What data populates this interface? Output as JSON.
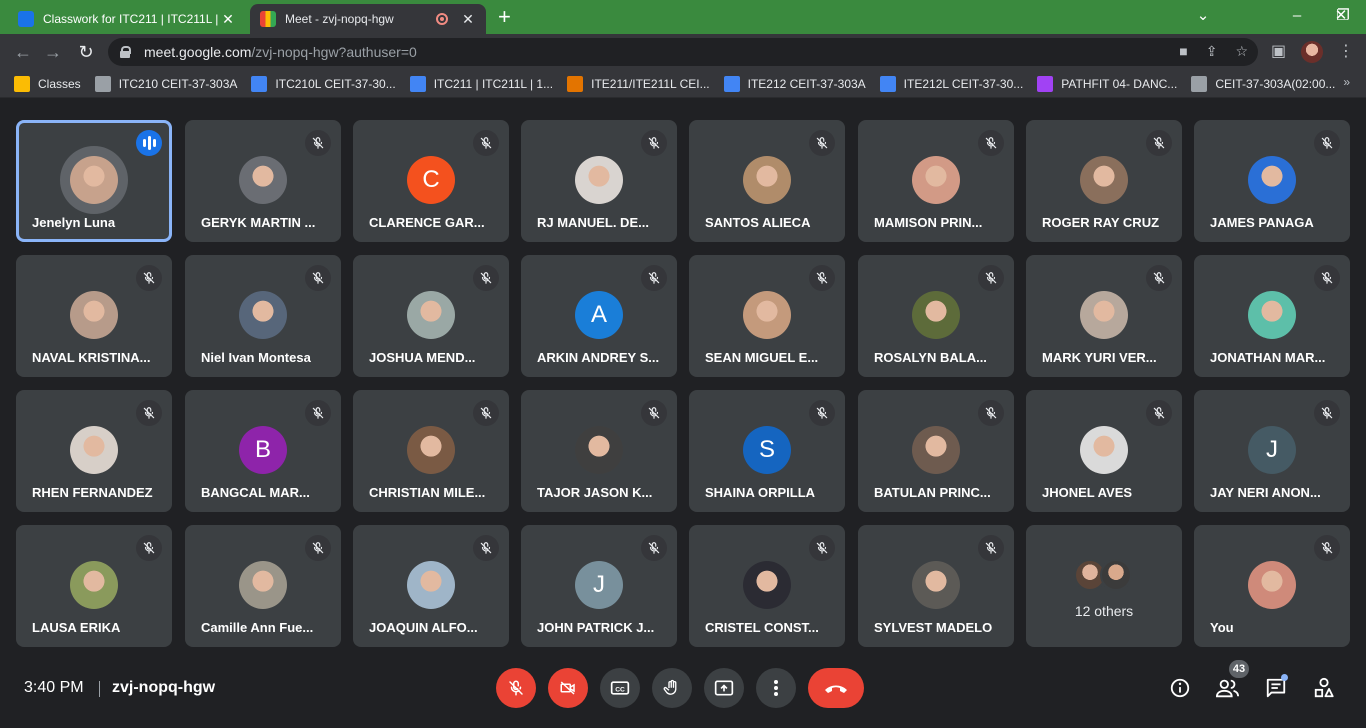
{
  "browser": {
    "tabs": [
      {
        "title": "Classwork for ITC211 | ITC211L | ",
        "icon": "classroom-favicon",
        "color": "#1e8e3e"
      },
      {
        "title": "Meet - zvj-nopq-hgw",
        "icon": "meet-favicon",
        "color": "#00832d"
      }
    ],
    "url_domain": "meet.google.com",
    "url_path": "/zvj-nopq-hgw?authuser=0",
    "bookmarks": [
      {
        "label": "Classes",
        "color": "#fbbc04"
      },
      {
        "label": "ITC210 CEIT-37-303A",
        "color": "#9aa0a6"
      },
      {
        "label": "ITC210L CEIT-37-30...",
        "color": "#4285f4"
      },
      {
        "label": "ITC211 | ITC211L | 1...",
        "color": "#4285f4"
      },
      {
        "label": "ITE211/ITE211L CEI...",
        "color": "#e37400"
      },
      {
        "label": "ITE212 CEIT-37-303A",
        "color": "#4285f4"
      },
      {
        "label": "ITE212L CEIT-37-30...",
        "color": "#4285f4"
      },
      {
        "label": "PATHFIT 04- DANC...",
        "color": "#a142f4"
      },
      {
        "label": "CEIT-37-303A(02:00...",
        "color": "#9aa0a6"
      }
    ],
    "bookmarks_more": "»"
  },
  "participants": [
    {
      "name": "Jenelyn Luna",
      "speaking": true,
      "avatar": "photo",
      "bg": "#c7a28c"
    },
    {
      "name": "GERYK MARTIN ...",
      "avatar": "photo",
      "bg": "#6a6d73"
    },
    {
      "name": "CLARENCE GAR...",
      "avatar": "letter",
      "letter": "C",
      "bg": "#f4511e"
    },
    {
      "name": "RJ MANUEL. DE...",
      "avatar": "photo",
      "bg": "#d9d4d0"
    },
    {
      "name": "SANTOS ALIECA",
      "avatar": "photo",
      "bg": "#b08c6a"
    },
    {
      "name": "MAMISON PRIN...",
      "avatar": "photo",
      "bg": "#d29a86"
    },
    {
      "name": "ROGER RAY CRUZ",
      "avatar": "photo",
      "bg": "#8a6f5c"
    },
    {
      "name": "JAMES PANAGA",
      "avatar": "photo",
      "bg": "#2a6fd6"
    },
    {
      "name": "NAVAL KRISTINA...",
      "avatar": "photo",
      "bg": "#b79b8a"
    },
    {
      "name": "Niel Ivan Montesa",
      "avatar": "photo",
      "bg": "#57667a"
    },
    {
      "name": "JOSHUA MEND...",
      "avatar": "photo",
      "bg": "#9aa8a5"
    },
    {
      "name": "ARKIN ANDREY S...",
      "avatar": "letter",
      "letter": "A",
      "bg": "#1a7ed8"
    },
    {
      "name": "SEAN MIGUEL E...",
      "avatar": "photo",
      "bg": "#c49a7c"
    },
    {
      "name": "ROSALYN BALA...",
      "avatar": "photo",
      "bg": "#5d6b3a"
    },
    {
      "name": "MARK YURI VER...",
      "avatar": "photo",
      "bg": "#b7a89c"
    },
    {
      "name": "JONATHAN MAR...",
      "avatar": "photo",
      "bg": "#5dbfa9"
    },
    {
      "name": "RHEN FERNANDEZ",
      "avatar": "photo",
      "bg": "#d7cfc8"
    },
    {
      "name": "BANGCAL MAR...",
      "avatar": "letter",
      "letter": "B",
      "bg": "#8e24aa"
    },
    {
      "name": "CHRISTIAN MILE...",
      "avatar": "photo",
      "bg": "#7a5a44"
    },
    {
      "name": "TAJOR JASON K...",
      "avatar": "photo",
      "bg": "#3f3f3f"
    },
    {
      "name": "SHAINA ORPILLA",
      "avatar": "letter",
      "letter": "S",
      "bg": "#1565c0"
    },
    {
      "name": "BATULAN PRINC...",
      "avatar": "photo",
      "bg": "#6e5b4f"
    },
    {
      "name": "JHONEL AVES",
      "avatar": "photo",
      "bg": "#dadada"
    },
    {
      "name": "JAY NERI ANON...",
      "avatar": "letter",
      "letter": "J",
      "bg": "#455a64"
    },
    {
      "name": "LAUSA ERIKA",
      "avatar": "photo",
      "bg": "#8a9a5c"
    },
    {
      "name": "Camille Ann Fue...",
      "avatar": "photo",
      "bg": "#9a9589"
    },
    {
      "name": "JOAQUIN ALFO...",
      "avatar": "photo",
      "bg": "#9fb5c8"
    },
    {
      "name": "JOHN PATRICK J...",
      "avatar": "letter",
      "letter": "J",
      "bg": "#78909c"
    },
    {
      "name": "CRISTEL CONST...",
      "avatar": "photo",
      "bg": "#2b2b33"
    },
    {
      "name": "SYLVEST MADELO",
      "avatar": "photo",
      "bg": "#5c5a56"
    },
    {
      "name": "12 others",
      "avatar": "others"
    },
    {
      "name": "You",
      "avatar": "photo",
      "bg": "#cf8a7a"
    }
  ],
  "bottom": {
    "time": "3:40 PM",
    "meeting_code": "zvj-nopq-hgw",
    "people_count": "43"
  },
  "colors": {
    "accent": "#8ab4f8",
    "danger": "#ea4335",
    "tile_bg": "#3c4043"
  }
}
